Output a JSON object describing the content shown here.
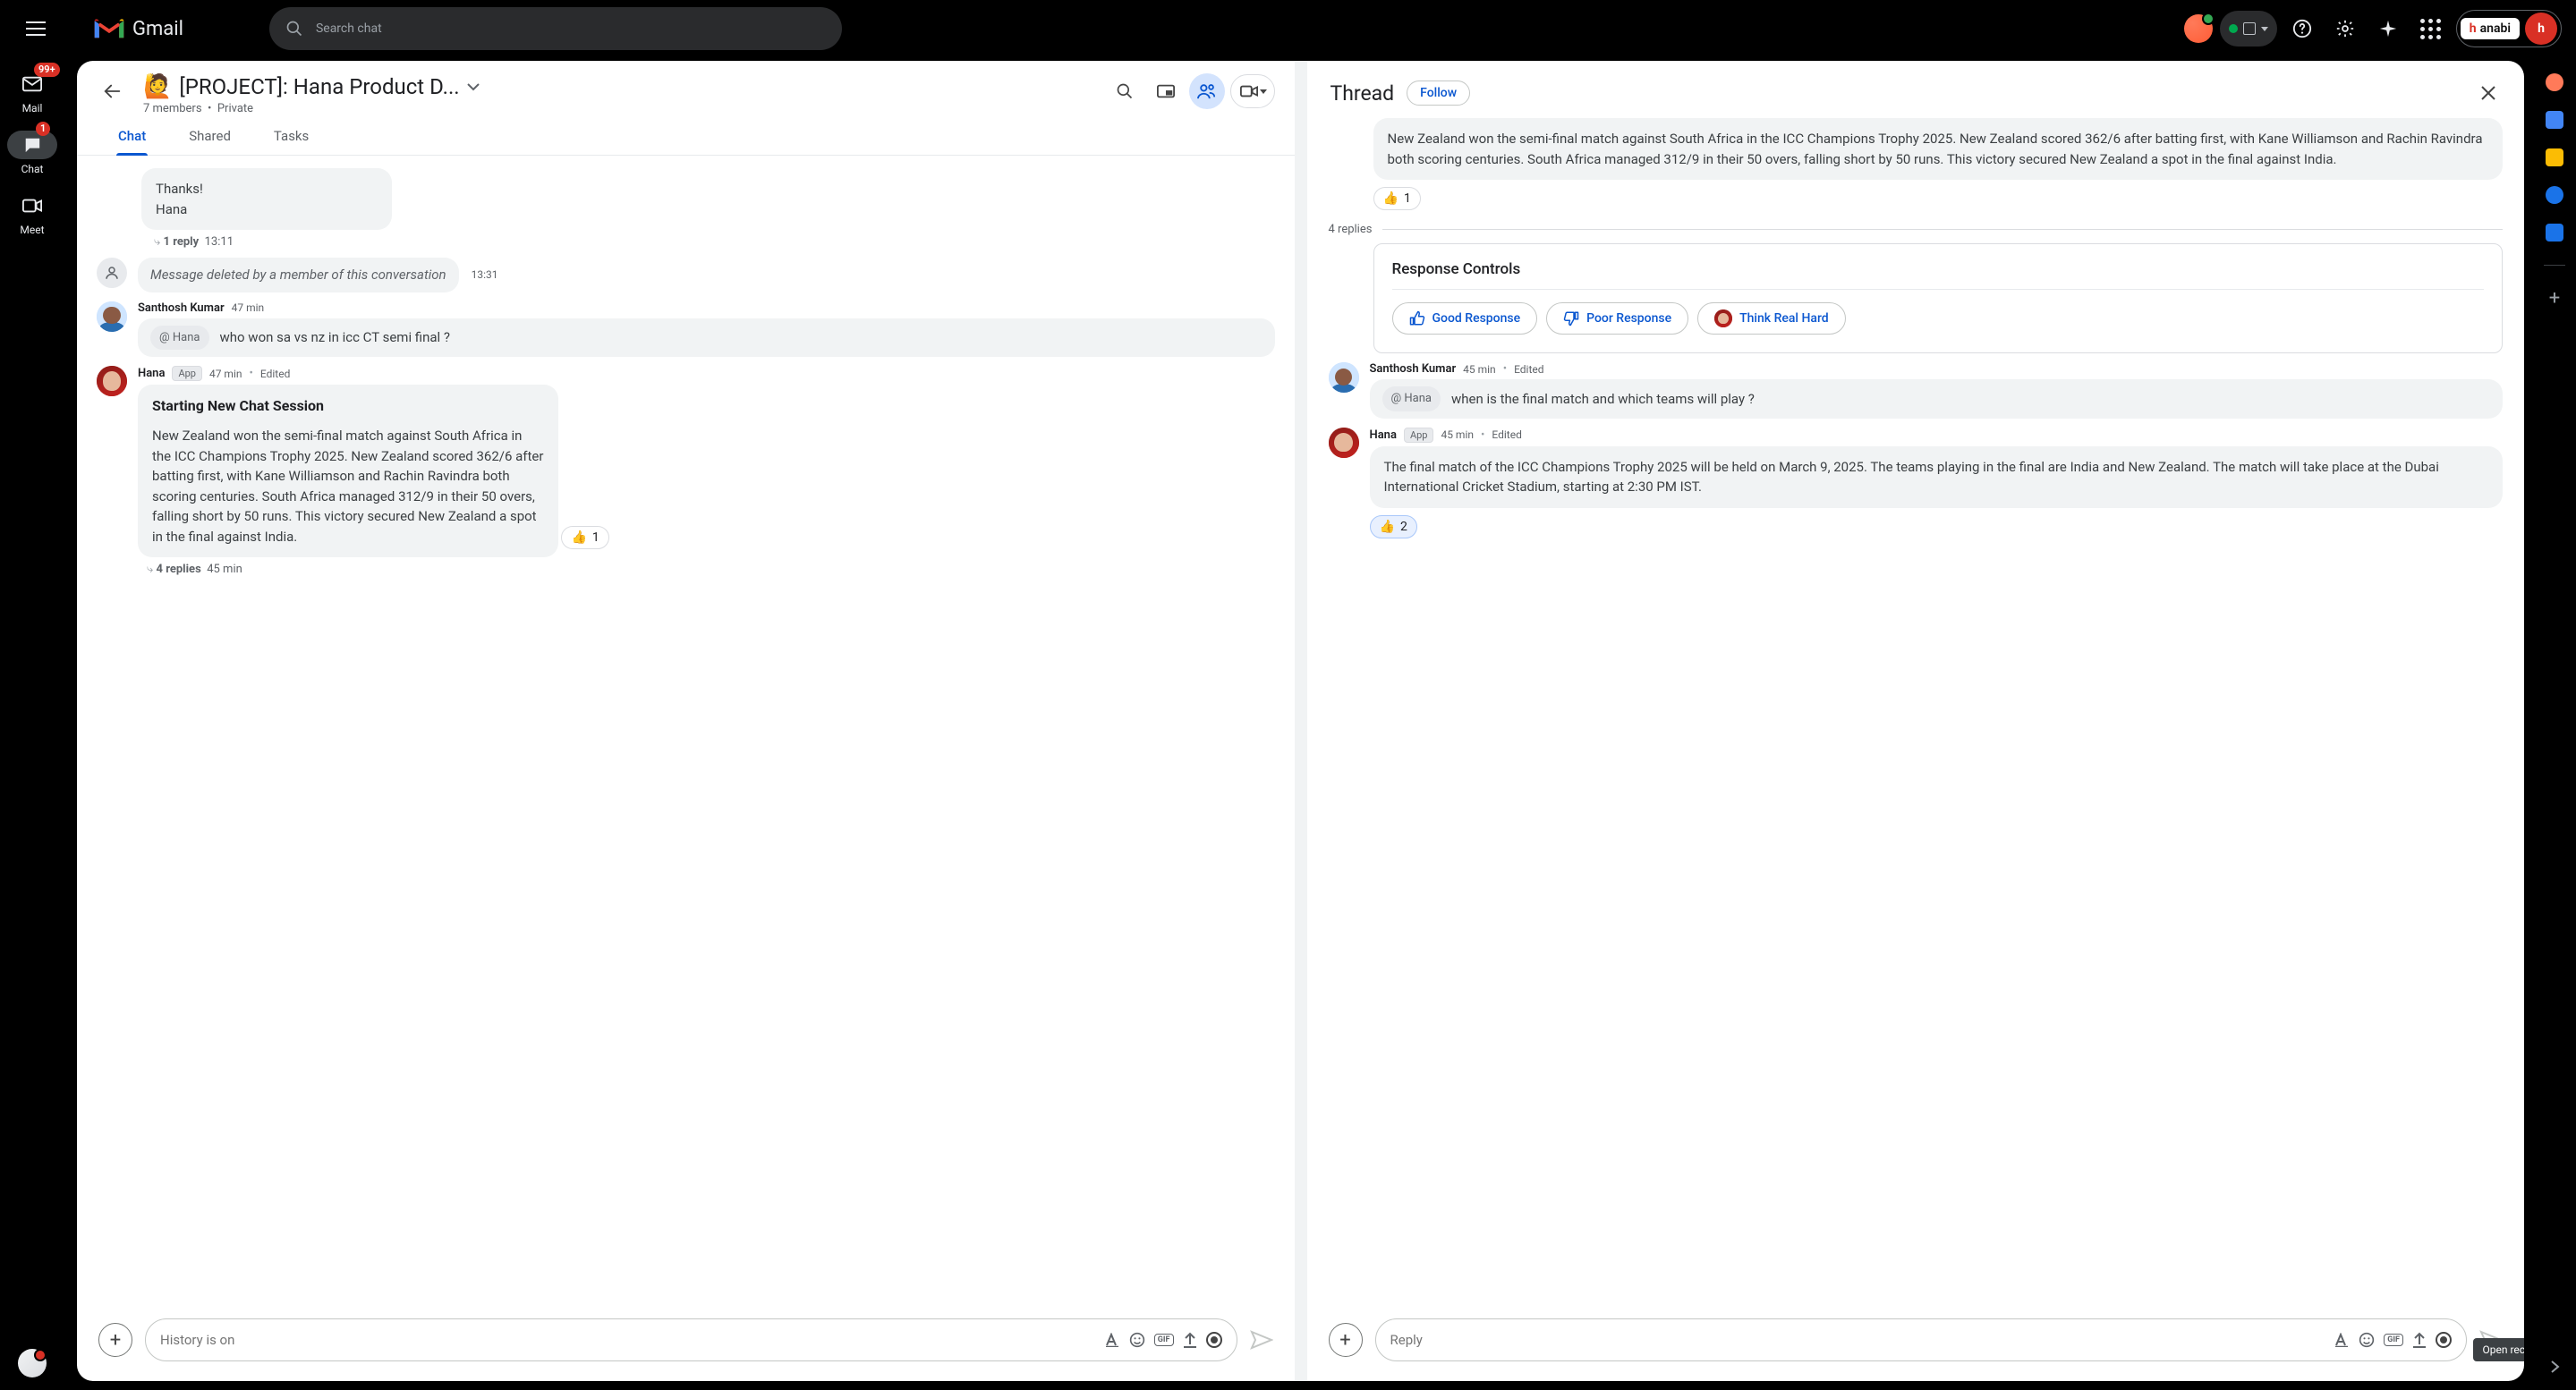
{
  "header": {
    "product": "Gmail",
    "search_placeholder": "Search chat",
    "hanabi_brand_prefix": "h",
    "hanabi_brand_rest": "anabi",
    "avatar_letter": "h"
  },
  "rail": {
    "mail": {
      "label": "Mail",
      "badge": "99+"
    },
    "chat": {
      "label": "Chat",
      "badge": "1"
    },
    "meet": {
      "label": "Meet"
    }
  },
  "room": {
    "emoji": "🙋",
    "title": "[PROJECT]: Hana Product D...",
    "subtitle_members": "7 members",
    "subtitle_privacy": "Private",
    "tabs": {
      "chat": "Chat",
      "shared": "Shared",
      "tasks": "Tasks"
    }
  },
  "chat": {
    "msg_thanks_line1": "Thanks!",
    "msg_thanks_line2": "Hana",
    "reply_meta_1": "1 reply",
    "reply_time_1": "13:11",
    "deleted_text": "Message deleted by a member of this conversation",
    "deleted_time": "13:31",
    "santhosh": {
      "name": "Santhosh Kumar",
      "time": "47 min",
      "mention": "@ Hana",
      "text": "who won sa vs nz in icc CT semi final ?"
    },
    "hana_reply": {
      "name": "Hana",
      "app_tag": "App",
      "time": "47 min",
      "edited": "Edited",
      "session_title": "Starting New Chat Session",
      "body": "New Zealand won the semi-final match against South Africa in the ICC Champions Trophy 2025. New Zealand scored 362/6 after batting first, with Kane Williamson and Rachin Ravindra both scoring centuries. South Africa managed 312/9 in their 50 overs, falling short by 50 runs. This victory secured New Zealand a spot in the final against India.",
      "react_emoji": "👍",
      "react_count": "1",
      "replies_label": "4 replies",
      "replies_time": "45 min"
    }
  },
  "compose_left": {
    "placeholder": "History is on"
  },
  "thread": {
    "title": "Thread",
    "follow": "Follow",
    "first_body": "New Zealand won the semi-final match against South Africa in the ICC Champions Trophy 2025. New Zealand scored 362/6 after batting first, with Kane Williamson and Rachin Ravindra both scoring centuries. South Africa managed 312/9 in their 50 overs, falling short by 50 runs. This victory secured New Zealand a spot in the final against India.",
    "react1_emoji": "👍",
    "react1_count": "1",
    "replies_sep": "4 replies",
    "response_controls": {
      "title": "Response Controls",
      "good": "Good Response",
      "poor": "Poor Response",
      "think": "Think Real Hard"
    },
    "santhosh2": {
      "name": "Santhosh Kumar",
      "time": "45 min",
      "edited": "Edited",
      "mention": "@ Hana",
      "text": "when is the final match and which teams will play ?"
    },
    "hana2": {
      "name": "Hana",
      "app_tag": "App",
      "time": "45 min",
      "edited": "Edited",
      "body": "The final match of the ICC Champions Trophy 2025 will be held on March 9, 2025. The teams playing in the final are India and New Zealand. The match will take place at the Dubai International Cricket Stadium, starting at 2:30 PM IST.",
      "react_emoji": "👍",
      "react_count": "2"
    }
  },
  "compose_right": {
    "placeholder": "Reply"
  },
  "tooltip": "Open recording menu"
}
